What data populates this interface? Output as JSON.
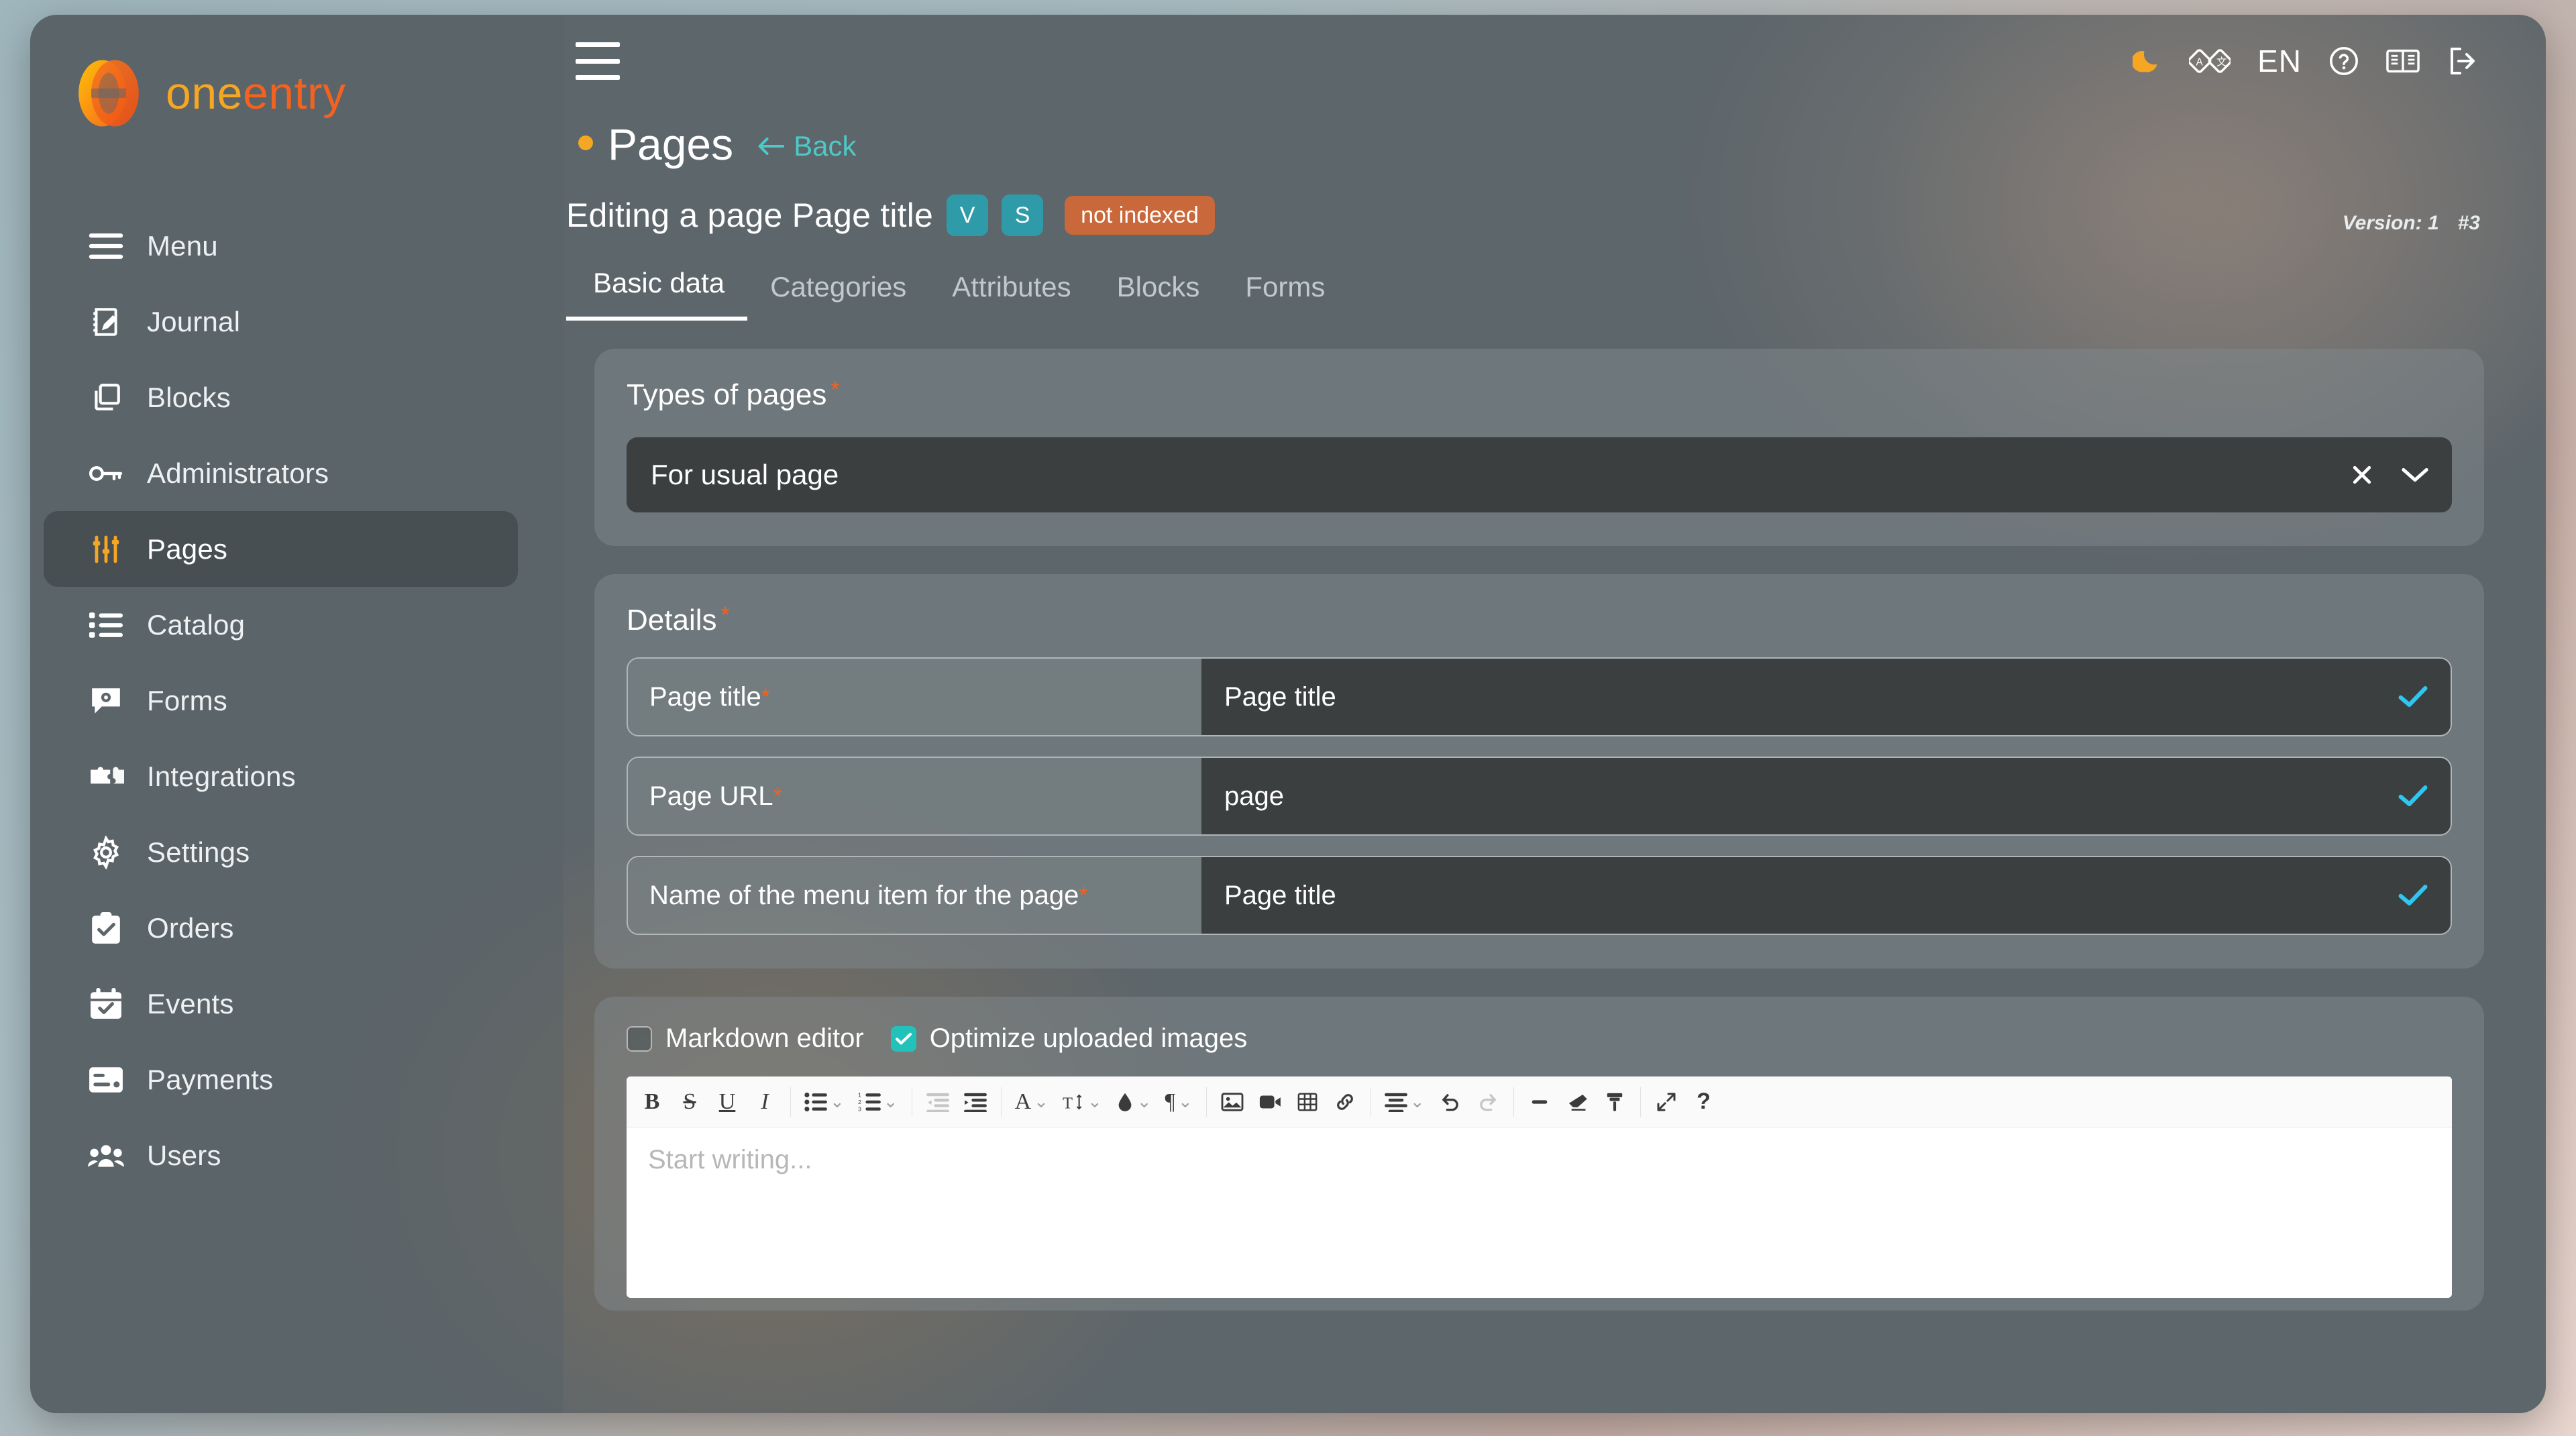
{
  "brand": {
    "part1": "one",
    "part2": "entry"
  },
  "sidebar": {
    "items": [
      {
        "label": "Menu",
        "icon": "hamburger-icon",
        "active": false
      },
      {
        "label": "Journal",
        "icon": "notebook-pen-icon",
        "active": false
      },
      {
        "label": "Blocks",
        "icon": "copy-squares-icon",
        "active": false
      },
      {
        "label": "Administrators",
        "icon": "key-icon",
        "active": false
      },
      {
        "label": "Pages",
        "icon": "sliders-icon",
        "active": true
      },
      {
        "label": "Catalog",
        "icon": "list-bullets-icon",
        "active": false
      },
      {
        "label": "Forms",
        "icon": "chat-gear-icon",
        "active": false
      },
      {
        "label": "Integrations",
        "icon": "puzzle-icon",
        "active": false
      },
      {
        "label": "Settings",
        "icon": "gear-icon",
        "active": false
      },
      {
        "label": "Orders",
        "icon": "clipboard-check-icon",
        "active": false
      },
      {
        "label": "Events",
        "icon": "calendar-check-icon",
        "active": false
      },
      {
        "label": "Payments",
        "icon": "credit-card-icon",
        "active": false
      },
      {
        "label": "Users",
        "icon": "users-icon",
        "active": false
      }
    ]
  },
  "topbar": {
    "menu_toggle": "hamburger-icon",
    "theme_toggle": "moon-icon",
    "translate": "translate-icon",
    "language": "EN",
    "help": "question-circle-icon",
    "docs": "book-icon",
    "logout": "logout-icon"
  },
  "header": {
    "title": "Pages",
    "back_label": "Back"
  },
  "edit": {
    "title": "Editing a page Page title",
    "badge_v": "V",
    "badge_s": "S",
    "badge_index": "not indexed",
    "version_label": "Version: 1",
    "version_number": "#3"
  },
  "tabs": [
    {
      "label": "Basic data",
      "active": true
    },
    {
      "label": "Categories",
      "active": false
    },
    {
      "label": "Attributes",
      "active": false
    },
    {
      "label": "Blocks",
      "active": false
    },
    {
      "label": "Forms",
      "active": false
    }
  ],
  "types_card": {
    "title": "Types of pages",
    "required_mark": "*",
    "selected_value": "For usual page",
    "clear_icon": "close-icon",
    "expand_icon": "chevron-down-icon"
  },
  "details_card": {
    "title": "Details",
    "required_mark": "*",
    "rows": [
      {
        "label": "Page title",
        "required": "*",
        "value": "Page title",
        "valid_icon": "check-icon"
      },
      {
        "label": "Page URL",
        "required": "*",
        "value": "page",
        "valid_icon": "check-icon"
      },
      {
        "label": "Name of the menu item for the page",
        "required": "*",
        "value": "Page title",
        "valid_icon": "check-icon"
      }
    ]
  },
  "editor_card": {
    "markdown_label": "Markdown editor",
    "markdown_checked": false,
    "optimize_label": "Optimize uploaded images",
    "optimize_checked": true,
    "placeholder": "Start writing...",
    "toolbar": [
      {
        "name": "bold-icon",
        "glyph": "B",
        "caret": false,
        "disabled": false
      },
      {
        "name": "strikethrough-icon",
        "glyph": "S",
        "caret": false,
        "disabled": false
      },
      {
        "name": "underline-icon",
        "glyph": "U",
        "caret": false,
        "disabled": false
      },
      {
        "name": "italic-icon",
        "glyph": "I",
        "caret": false,
        "disabled": false
      },
      {
        "name": "bullet-list-icon",
        "glyph": "",
        "caret": true,
        "disabled": false
      },
      {
        "name": "numbered-list-icon",
        "glyph": "",
        "caret": true,
        "disabled": false
      },
      {
        "name": "outdent-icon",
        "glyph": "",
        "caret": false,
        "disabled": true
      },
      {
        "name": "indent-icon",
        "glyph": "",
        "caret": false,
        "disabled": false
      },
      {
        "name": "font-color-icon",
        "glyph": "A",
        "caret": true,
        "disabled": false
      },
      {
        "name": "font-size-icon",
        "glyph": "",
        "caret": true,
        "disabled": false
      },
      {
        "name": "highlight-color-icon",
        "glyph": "",
        "caret": true,
        "disabled": false
      },
      {
        "name": "paragraph-icon",
        "glyph": "",
        "caret": true,
        "disabled": false
      },
      {
        "name": "insert-image-icon",
        "glyph": "",
        "caret": false,
        "disabled": false
      },
      {
        "name": "insert-video-icon",
        "glyph": "",
        "caret": false,
        "disabled": false
      },
      {
        "name": "insert-table-icon",
        "glyph": "",
        "caret": false,
        "disabled": false
      },
      {
        "name": "insert-link-icon",
        "glyph": "",
        "caret": false,
        "disabled": false
      },
      {
        "name": "align-icon",
        "glyph": "",
        "caret": true,
        "disabled": false
      },
      {
        "name": "undo-icon",
        "glyph": "",
        "caret": false,
        "disabled": false
      },
      {
        "name": "redo-icon",
        "glyph": "",
        "caret": false,
        "disabled": true
      },
      {
        "name": "horizontal-rule-icon",
        "glyph": "",
        "caret": false,
        "disabled": false
      },
      {
        "name": "eraser-icon",
        "glyph": "",
        "caret": false,
        "disabled": false
      },
      {
        "name": "format-painter-icon",
        "glyph": "",
        "caret": false,
        "disabled": false
      },
      {
        "name": "fullscreen-icon",
        "glyph": "",
        "caret": false,
        "disabled": false
      },
      {
        "name": "help-icon",
        "glyph": "?",
        "caret": false,
        "disabled": false
      }
    ]
  },
  "colors": {
    "accent_orange": "#f4621f",
    "accent_yellow": "#f5a623",
    "teal": "#4ec9c6",
    "badge_teal": "#2f9ba8",
    "badge_orange": "#c9683a",
    "check_blue": "#2fc6ef",
    "checkbox_green": "#22c2bb",
    "app_bg": "#5d666b",
    "field_bg": "#3c3f40"
  }
}
